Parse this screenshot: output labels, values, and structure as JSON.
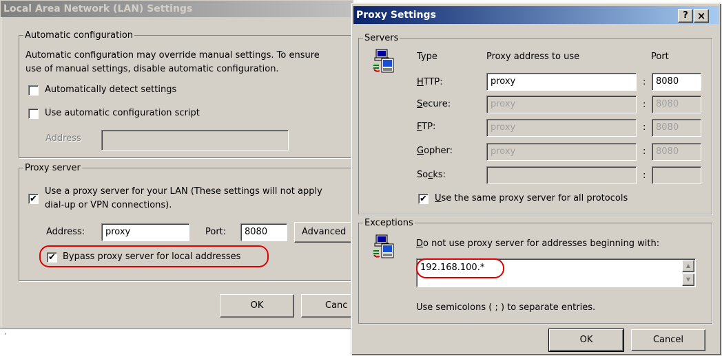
{
  "lan": {
    "title": "Local Area Network (LAN) Settings",
    "auto_group": "Automatic configuration",
    "auto_desc_1": "Automatic configuration may override manual settings.  To ensure",
    "auto_desc_2": "use of manual settings, disable automatic configuration.",
    "auto_detect": {
      "label": "Automatically detect settings",
      "checked": false
    },
    "auto_script": {
      "label": "Use automatic configuration script",
      "checked": false
    },
    "address_label": "Address",
    "address_value": "",
    "proxy_group": "Proxy server",
    "use_proxy": {
      "label_1": "Use a proxy server for your LAN (These settings will not apply",
      "label_2": "dial-up or VPN connections).",
      "checked": true
    },
    "proxy_address_label": "Address:",
    "proxy_address_value": "proxy",
    "port_label": "Port:",
    "port_value": "8080",
    "advanced_label": "Advanced",
    "bypass": {
      "label": "Bypass proxy server for local addresses",
      "checked": true
    },
    "ok_label": "OK",
    "cancel_label": "Canc"
  },
  "proxy": {
    "title": "Proxy Settings",
    "help_label": "?",
    "close_label": "×",
    "servers_group": "Servers",
    "col_type": "Type",
    "col_address": "Proxy address to use",
    "col_port": "Port",
    "rows": [
      {
        "type_pre": "",
        "type_key": "H",
        "type_post": "TTP:",
        "address": "proxy",
        "port": "8080",
        "enabled": true
      },
      {
        "type_pre": "",
        "type_key": "S",
        "type_post": "ecure:",
        "address": "proxy",
        "port": "8080",
        "enabled": false
      },
      {
        "type_pre": "",
        "type_key": "F",
        "type_post": "TP:",
        "address": "proxy",
        "port": "8080",
        "enabled": false
      },
      {
        "type_pre": "",
        "type_key": "G",
        "type_post": "opher:",
        "address": "proxy",
        "port": "8080",
        "enabled": false
      },
      {
        "type_pre": "So",
        "type_key": "c",
        "type_post": "ks:",
        "address": "",
        "port": "",
        "enabled": false
      }
    ],
    "colon": ":",
    "same_proxy": {
      "key": "U",
      "label": "se the same proxy server for all protocols",
      "checked": true
    },
    "exceptions_group": "Exceptions",
    "exceptions_desc_key": "D",
    "exceptions_desc": "o not use proxy server for addresses beginning with:",
    "exceptions_value": "192.168.100.*",
    "exceptions_hint": "Use semicolons ( ; ) to separate entries.",
    "ok_label": "OK",
    "cancel_label": "Cancel"
  },
  "icons": [
    "network-computers-icon",
    "scroll-up-arrow-icon",
    "scroll-down-arrow-icon",
    "checkmark-icon"
  ],
  "colors": {
    "highlight_ring": "#e00000",
    "title_active": "#0a246a",
    "dialog_bg": "#d4d0c8"
  }
}
